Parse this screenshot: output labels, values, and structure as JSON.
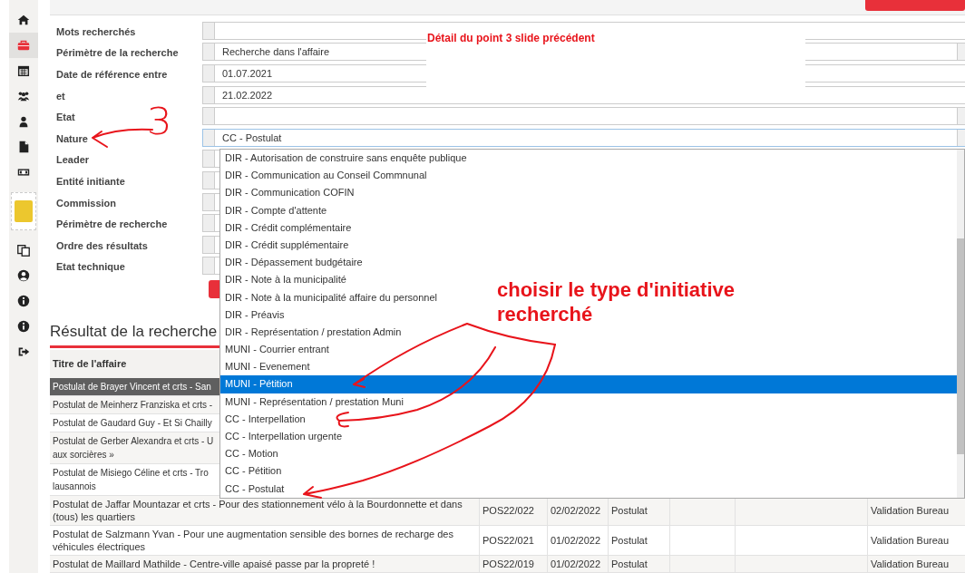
{
  "sidebar": {
    "items": [
      {
        "kind": "home",
        "selected": false
      },
      {
        "kind": "briefcase",
        "selected": true
      },
      {
        "kind": "calendar",
        "selected": false
      },
      {
        "kind": "group",
        "selected": false
      },
      {
        "kind": "user",
        "selected": false
      },
      {
        "kind": "file",
        "selected": false
      },
      {
        "kind": "money",
        "selected": false
      },
      {
        "kind": "note",
        "selected": false
      },
      {
        "kind": "copy",
        "selected": false
      },
      {
        "kind": "user-circle",
        "selected": false
      },
      {
        "kind": "info",
        "selected": false
      },
      {
        "kind": "info",
        "selected": false
      },
      {
        "kind": "sign-out",
        "selected": false
      }
    ]
  },
  "form": {
    "fields": [
      {
        "label": "Mots recherchés",
        "kind": "text",
        "open": false
      },
      {
        "label": "Périmètre de la recherche",
        "kind": "select",
        "value": "Recherche dans l'affaire",
        "open": false
      },
      {
        "label": "Date de référence entre",
        "kind": "text",
        "value": "01.07.2021",
        "open": false
      },
      {
        "label": "et",
        "kind": "text",
        "value": "21.02.2022",
        "open": false
      },
      {
        "label": "Etat",
        "kind": "select",
        "open": false
      },
      {
        "label": "Nature",
        "kind": "select",
        "value": "CC - Postulat",
        "open": true
      },
      {
        "label": "Leader",
        "kind": "text",
        "open": false
      },
      {
        "label": "Entité initiante",
        "kind": "text",
        "open": false
      },
      {
        "label": "Commission",
        "kind": "text",
        "open": false
      },
      {
        "label": "Périmètre de recherche",
        "kind": "text",
        "open": false
      },
      {
        "label": "Ordre des résultats",
        "kind": "text",
        "open": false
      },
      {
        "label": "Etat technique",
        "kind": "text",
        "open": false
      }
    ],
    "dropdown": {
      "options": [
        {
          "label": "DIR - Autorisation de construire sans enquête publique",
          "selected": false
        },
        {
          "label": "DIR - Communication au Conseil Commnunal",
          "selected": false
        },
        {
          "label": "DIR - Communication COFIN",
          "selected": false
        },
        {
          "label": "DIR - Compte d'attente",
          "selected": false
        },
        {
          "label": "DIR - Crédit complémentaire",
          "selected": false
        },
        {
          "label": "DIR - Crédit supplémentaire",
          "selected": false
        },
        {
          "label": "DIR - Dépassement budgétaire",
          "selected": false
        },
        {
          "label": "DIR - Note à la municipalité",
          "selected": false
        },
        {
          "label": "DIR - Note à la municipalité affaire du personnel",
          "selected": false
        },
        {
          "label": "DIR - Préavis",
          "selected": false
        },
        {
          "label": "DIR - Représentation / prestation Admin",
          "selected": false
        },
        {
          "label": "MUNI - Courrier entrant",
          "selected": false
        },
        {
          "label": "MUNI - Evenement",
          "selected": false
        },
        {
          "label": "MUNI - Pétition",
          "selected": true
        },
        {
          "label": "MUNI - Représentation / prestation Muni",
          "selected": false
        },
        {
          "label": "CC - Interpellation",
          "selected": false
        },
        {
          "label": "CC - Interpellation urgente",
          "selected": false
        },
        {
          "label": "CC - Motion",
          "selected": false
        },
        {
          "label": "CC - Pétition",
          "selected": false
        },
        {
          "label": "CC - Postulat",
          "selected": false
        }
      ]
    }
  },
  "results": {
    "title": "Résultat de la recherche",
    "table": {
      "columns": [
        "Titre de l'affaire"
      ],
      "rows": [
        {
          "selected": true,
          "kind": "partial",
          "cells": [
            "Postulat de Brayer Vincent et crts - San"
          ]
        },
        {
          "selected": false,
          "kind": "partial",
          "cells": [
            "Postulat de Meinherz Franziska et crts -"
          ]
        },
        {
          "selected": false,
          "kind": "partial",
          "cells": [
            "Postulat de Gaudard Guy - Et Si Chailly"
          ]
        },
        {
          "selected": false,
          "kind": "partial",
          "cells": [
            "Postulat de Gerber Alexandra et crts - U\naux sorcières »"
          ]
        },
        {
          "selected": false,
          "kind": "partial",
          "cells": [
            "Postulat de Misiego Céline et crts - Tro\nlausannois"
          ]
        },
        {
          "selected": false,
          "kind": "full",
          "cells": [
            "Postulat de Jaffar Mountazar et crts - Pour des stationnement vélo à la Bourdonnette et dans (tous) les quartiers",
            "POS22/022",
            "02/02/2022",
            "Postulat",
            "",
            "",
            "Validation Bureau"
          ]
        },
        {
          "selected": false,
          "kind": "full",
          "cells": [
            "Postulat de Salzmann Yvan - Pour une augmentation sensible des bornes de recharge des véhicules électriques",
            "POS22/021",
            "01/02/2022",
            "Postulat",
            "",
            "",
            "Validation Bureau"
          ]
        },
        {
          "selected": false,
          "kind": "full",
          "cells": [
            "Postulat de Maillard Mathilde - Centre-ville apaisé passe par la propreté !",
            "POS22/019",
            "01/02/2022",
            "Postulat",
            "",
            "",
            "Validation Bureau"
          ]
        }
      ]
    }
  },
  "annotations": {
    "note": "Détail du point 3 slide précédent",
    "marker": "3",
    "callout": "choisir le type d'initiative recherché"
  }
}
